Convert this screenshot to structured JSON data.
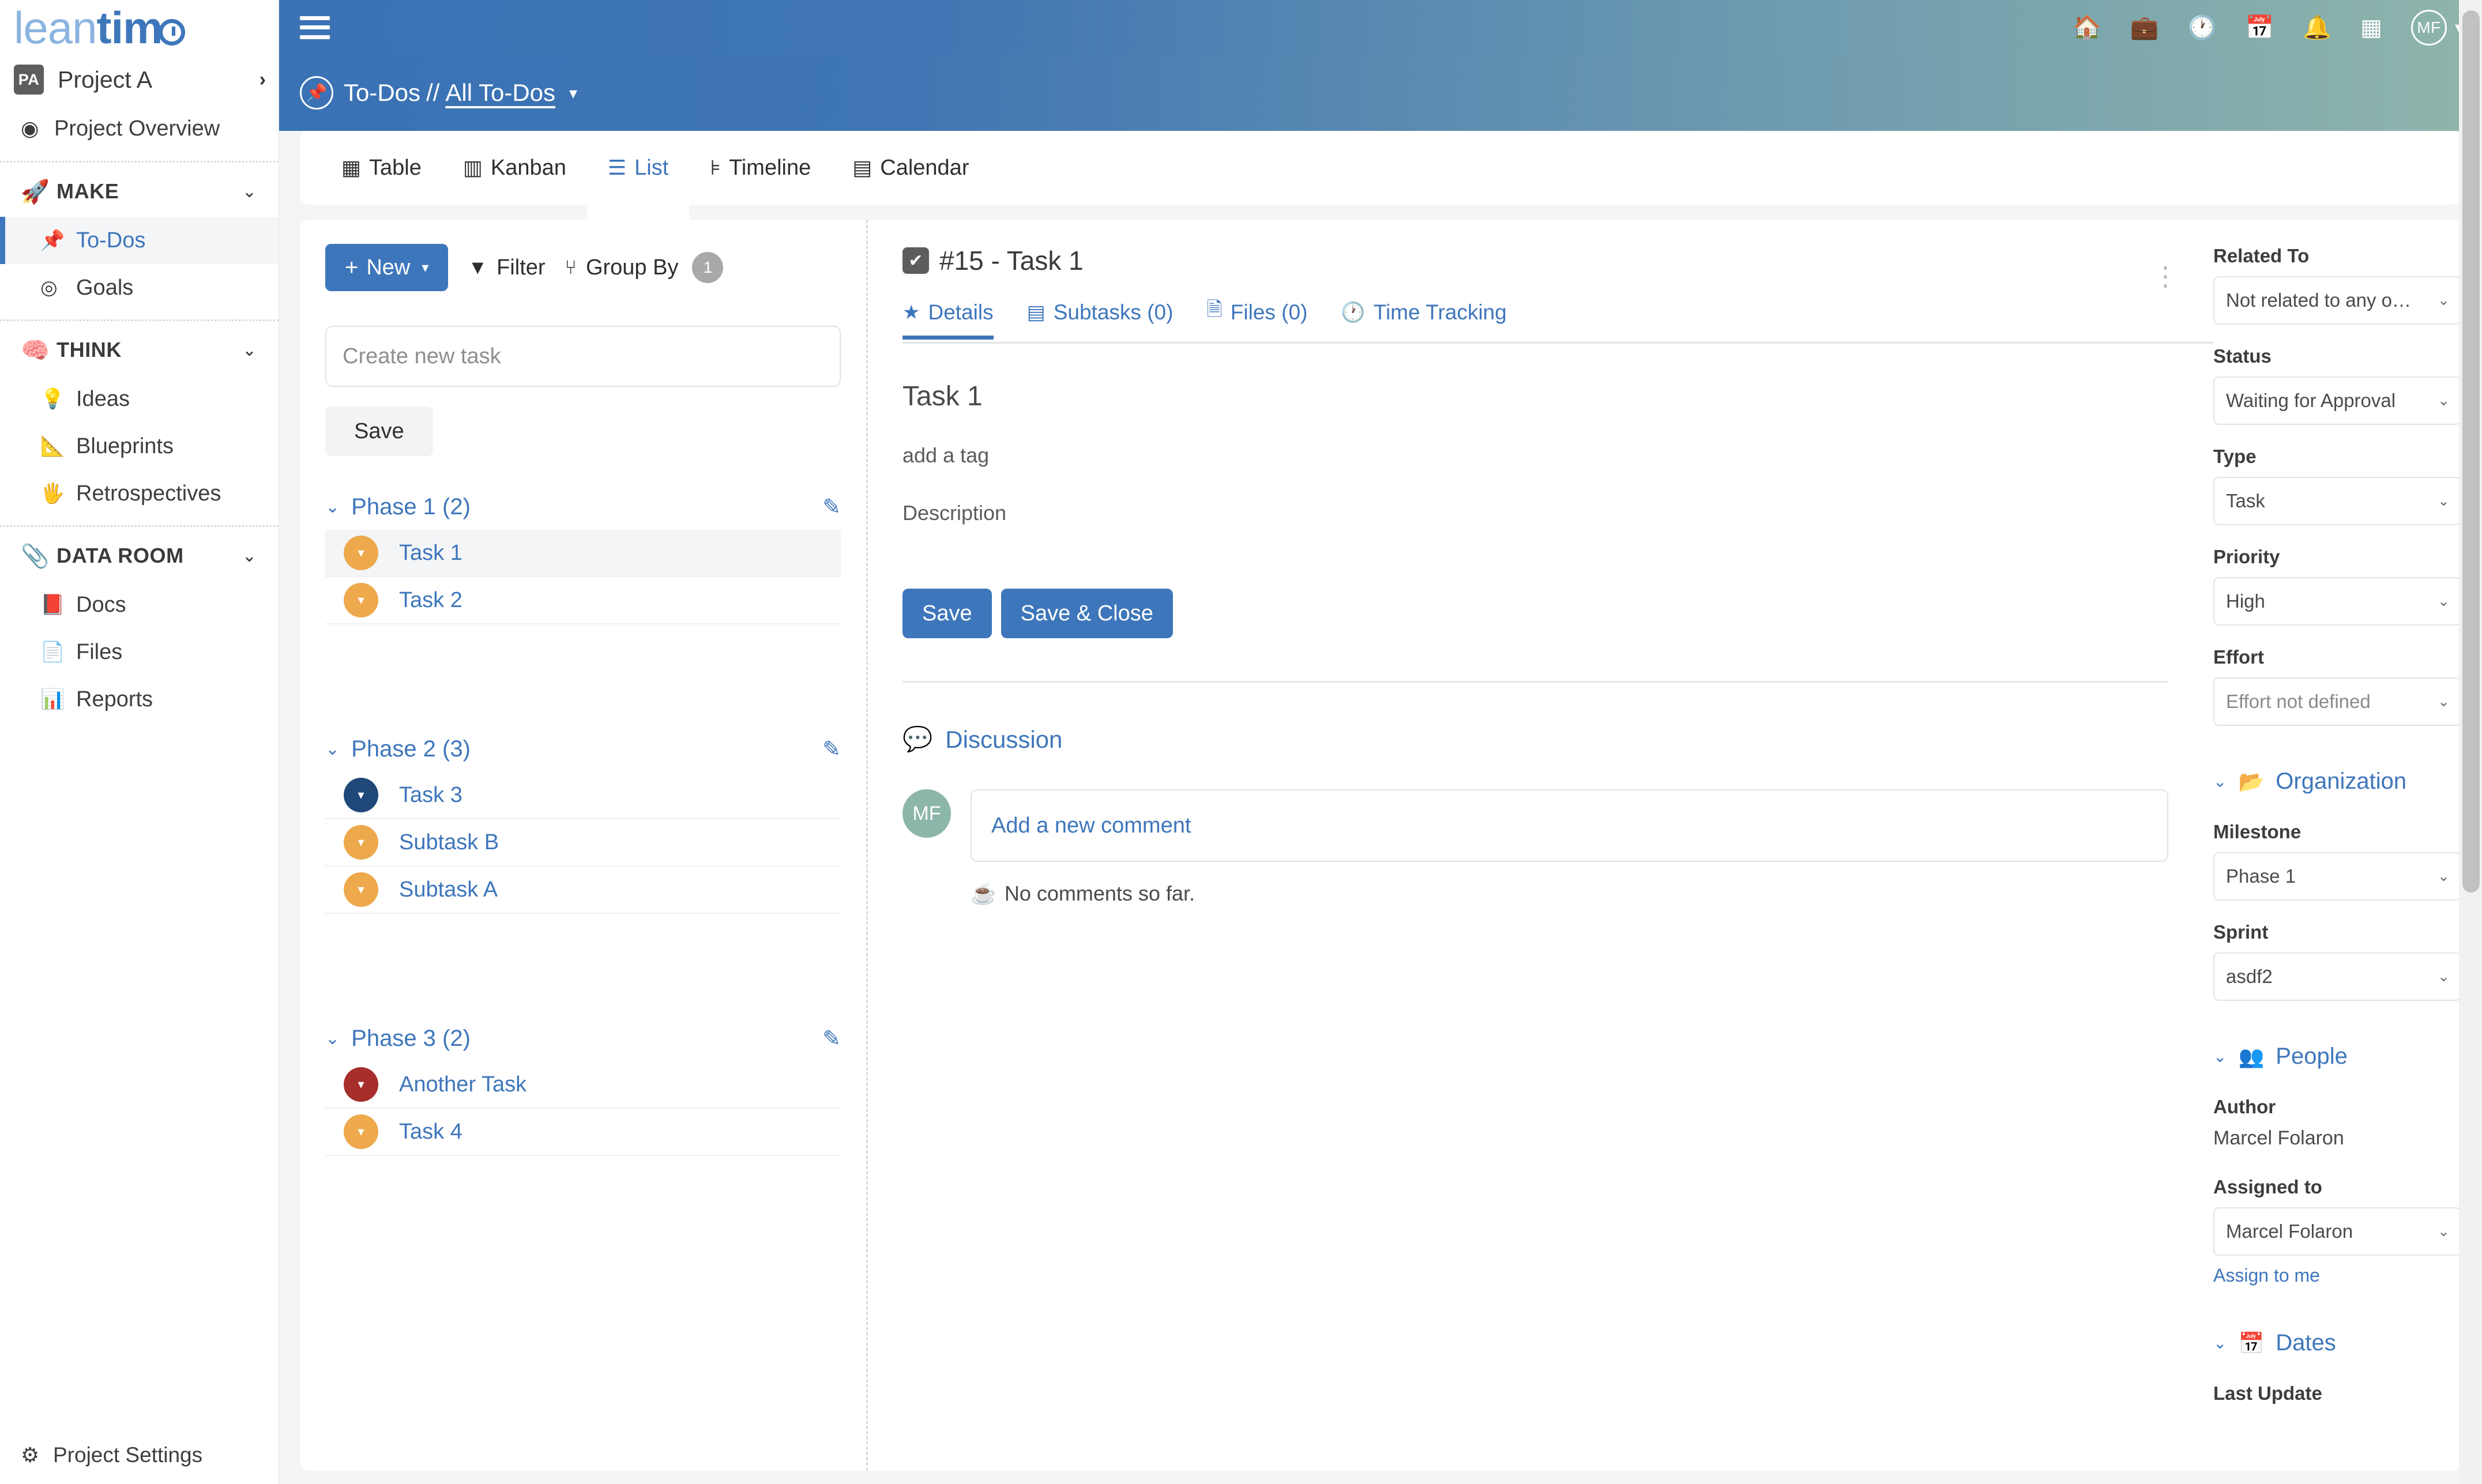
{
  "brand": {
    "lean": "lean",
    "time": "tim",
    "clock_icon": "clock-icon"
  },
  "sidebar": {
    "project": {
      "initials": "PA",
      "name": "Project A",
      "chevron": "›"
    },
    "overview": {
      "label": "Project Overview",
      "icon": "dashboard-icon",
      "glyph": "◉"
    },
    "groups": [
      {
        "label": "MAKE",
        "emoji": "🚀",
        "chevron": "⌄",
        "items": [
          {
            "label": "To-Dos",
            "glyph": "📌",
            "active": true
          },
          {
            "label": "Goals",
            "glyph": "◎",
            "active": false
          }
        ]
      },
      {
        "label": "THINK",
        "emoji": "🧠",
        "chevron": "⌄",
        "items": [
          {
            "label": "Ideas",
            "glyph": "💡",
            "active": false
          },
          {
            "label": "Blueprints",
            "glyph": "📐",
            "active": false
          },
          {
            "label": "Retrospectives",
            "glyph": "🖐",
            "active": false
          }
        ]
      },
      {
        "label": "DATA ROOM",
        "emoji": "📎",
        "chevron": "⌄",
        "items": [
          {
            "label": "Docs",
            "glyph": "📕",
            "active": false
          },
          {
            "label": "Files",
            "glyph": "📄",
            "active": false
          },
          {
            "label": "Reports",
            "glyph": "📊",
            "active": false
          }
        ]
      }
    ],
    "footer": {
      "label": "Project Settings",
      "glyph": "⚙"
    }
  },
  "topbar": {
    "menu_icon": "hamburger-menu-icon",
    "icons": [
      {
        "name": "home-icon",
        "glyph": "🏠"
      },
      {
        "name": "briefcase-icon",
        "glyph": "💼"
      },
      {
        "name": "clock-icon",
        "glyph": "🕐"
      },
      {
        "name": "calendar-icon",
        "glyph": "📅"
      },
      {
        "name": "bell-icon",
        "glyph": "🔔"
      },
      {
        "name": "grid-apps-icon",
        "glyph": "▦"
      }
    ],
    "avatar_initials": "MF",
    "avatar_caret": "▾"
  },
  "subheader": {
    "pin_icon": "pin-icon",
    "title": "To-Dos",
    "separator": "//",
    "filter_link": "All To-Dos",
    "caret": "▾"
  },
  "view_tabs": [
    {
      "label": "Table",
      "icon": "table-icon",
      "glyph": "▦",
      "active": false
    },
    {
      "label": "Kanban",
      "icon": "kanban-icon",
      "glyph": "▥",
      "active": false
    },
    {
      "label": "List",
      "icon": "list-icon",
      "glyph": "☰",
      "active": true
    },
    {
      "label": "Timeline",
      "icon": "timeline-icon",
      "glyph": "⊧",
      "active": false
    },
    {
      "label": "Calendar",
      "icon": "calendar-icon",
      "glyph": "▤",
      "active": false
    }
  ],
  "list_panel": {
    "new_button": {
      "label": "New",
      "plus": "+",
      "caret": "▾"
    },
    "filter_button": {
      "label": "Filter",
      "icon": "filter-icon",
      "glyph": "▼"
    },
    "group_by_button": {
      "label": "Group By",
      "icon": "group-by-icon",
      "glyph": "⑂",
      "count": "1"
    },
    "new_task_placeholder": "Create new task",
    "new_task_value": "",
    "save_button": "Save",
    "phases": [
      {
        "title": "Phase 1 (2)",
        "chevron": "⌄",
        "edit_icon": "edit-icon",
        "tasks": [
          {
            "name": "Task 1",
            "color": "orange",
            "selected": true
          },
          {
            "name": "Task 2",
            "color": "orange",
            "selected": false
          }
        ]
      },
      {
        "title": "Phase 2 (3)",
        "chevron": "⌄",
        "edit_icon": "edit-icon",
        "tasks": [
          {
            "name": "Task 3",
            "color": "navy",
            "selected": false
          },
          {
            "name": "Subtask B",
            "color": "orange",
            "selected": false
          },
          {
            "name": "Subtask A",
            "color": "orange",
            "selected": false
          }
        ]
      },
      {
        "title": "Phase 3 (2)",
        "chevron": "⌄",
        "edit_icon": "edit-icon",
        "tasks": [
          {
            "name": "Another Task",
            "color": "red",
            "selected": false
          },
          {
            "name": "Task 4",
            "color": "orange",
            "selected": false
          }
        ]
      }
    ]
  },
  "detail": {
    "checkbox_glyph": "✔",
    "title": "#15 - Task 1",
    "tabs": [
      {
        "label": "Details",
        "icon": "star-icon",
        "glyph": "★",
        "active": true
      },
      {
        "label": "Subtasks (0)",
        "icon": "subtask-icon",
        "glyph": "▤",
        "active": false
      },
      {
        "label": "Files (0)",
        "icon": "file-icon",
        "glyph": "🗎",
        "active": false
      },
      {
        "label": "Time Tracking",
        "icon": "clock-icon",
        "glyph": "🕐",
        "active": false
      }
    ],
    "overflow_menu": "⋮",
    "task_name": "Task 1",
    "tag_placeholder": "add a tag",
    "description_placeholder": "Description",
    "save_label": "Save",
    "save_close_label": "Save & Close",
    "discussion": {
      "heading": "Discussion",
      "icon": "comments-icon",
      "glyph": "💬",
      "avatar_initials": "MF",
      "comment_placeholder": "Add a new comment",
      "empty_icon": "coffee-icon",
      "empty_glyph": "☕",
      "empty_text": "No comments so far."
    }
  },
  "properties": {
    "fields": [
      {
        "label": "Related To",
        "value": "Not related to any o…",
        "muted": false
      },
      {
        "label": "Status",
        "value": "Waiting for Approval",
        "muted": false
      },
      {
        "label": "Type",
        "value": "Task",
        "muted": false
      },
      {
        "label": "Priority",
        "value": "High",
        "muted": false
      },
      {
        "label": "Effort",
        "value": "Effort not defined",
        "muted": true
      }
    ],
    "organization": {
      "heading": "Organization",
      "icon": "folder-icon",
      "glyph": "📂",
      "chevron": "⌄",
      "fields": [
        {
          "label": "Milestone",
          "value": "Phase 1"
        },
        {
          "label": "Sprint",
          "value": "asdf2"
        }
      ]
    },
    "people": {
      "heading": "People",
      "icon": "people-icon",
      "glyph": "👥",
      "chevron": "⌄",
      "author_label": "Author",
      "author_value": "Marcel Folaron",
      "assigned_label": "Assigned to",
      "assigned_value": "Marcel Folaron",
      "assign_link": "Assign to me"
    },
    "dates": {
      "heading": "Dates",
      "icon": "calendar-icon",
      "glyph": "📅",
      "chevron": "⌄",
      "last_update_label": "Last Update"
    }
  },
  "colors": {
    "accent": "#3e76bb",
    "header_start": "#3a72b5",
    "header_end": "#8fb5ab",
    "status_orange": "#eda94c",
    "status_navy": "#20497a",
    "status_red": "#a62e2b"
  }
}
